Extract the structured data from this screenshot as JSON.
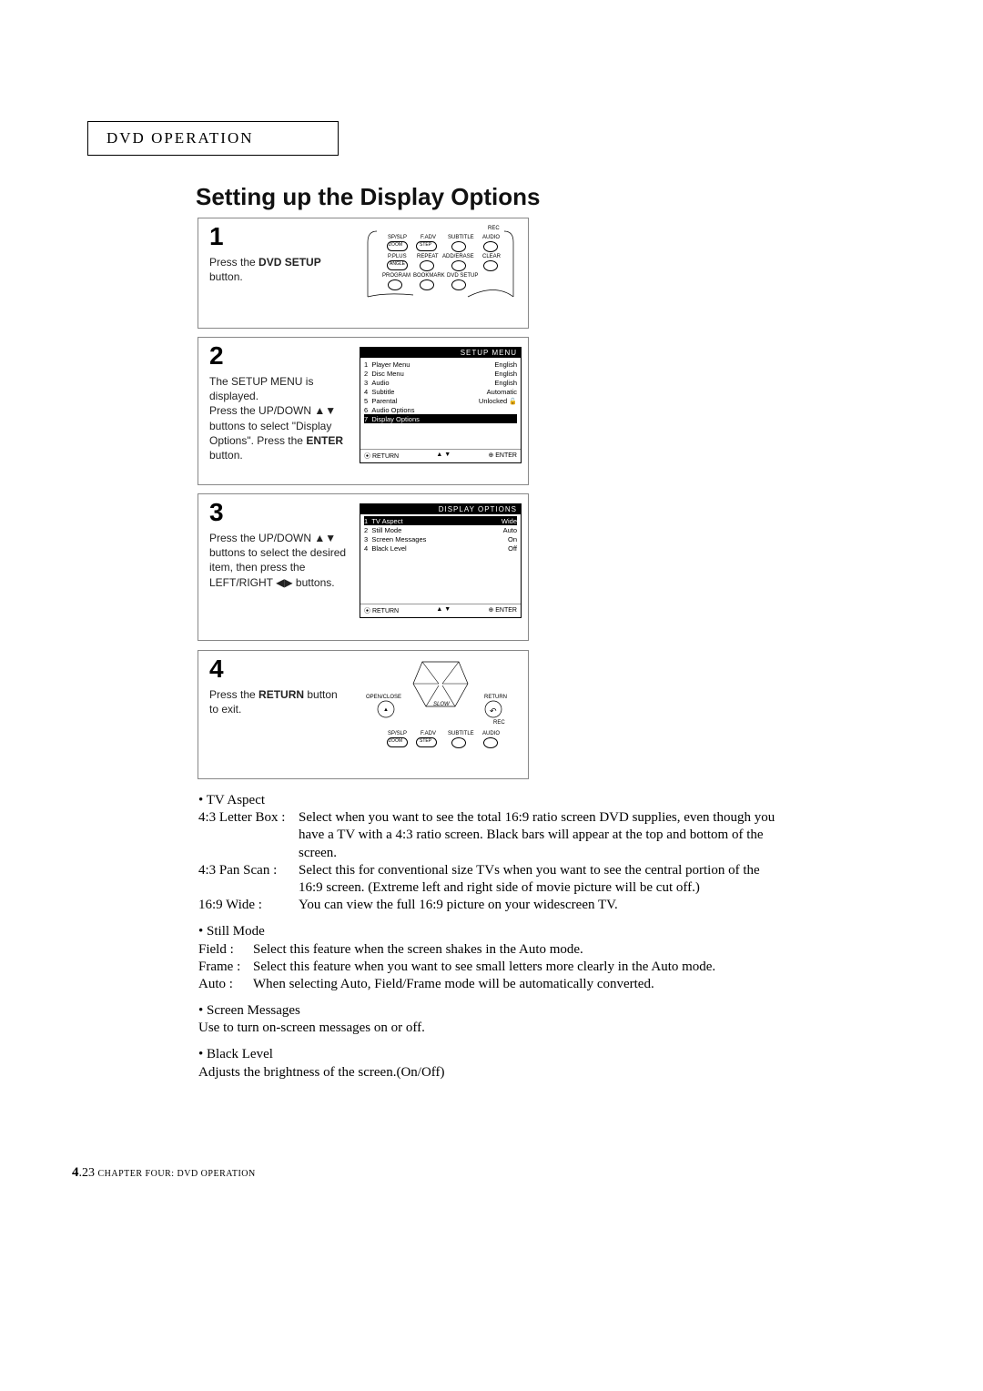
{
  "header": "DVD OPERATION",
  "title": "Setting up the Display Options",
  "steps": {
    "s1": {
      "num": "1",
      "line1a": "Press the ",
      "bold1": "DVD SETUP",
      "line1b": " button.",
      "remote": {
        "rec": "REC",
        "r1": [
          "SP/SLP",
          "F.ADV",
          "SUBTITLE",
          "AUDIO"
        ],
        "r1a": [
          "ZOOM",
          "STEP"
        ],
        "r2": [
          "P.PLUS",
          "REPEAT",
          "ADD/ERASE",
          "CLEAR"
        ],
        "r2a": [
          "ANGLE"
        ],
        "r3": [
          "PROGRAM",
          "BOOKMARK",
          "DVD SETUP"
        ]
      }
    },
    "s2": {
      "num": "2",
      "line1": "The SETUP MENU is displayed.",
      "line2a": "Press the UP/DOWN ▲▼ buttons to select \"Display Options\". Press the ",
      "bold1": "ENTER",
      "line2b": " button.",
      "screen": {
        "title": "SETUP MENU",
        "items": [
          {
            "n": "1",
            "label": "Player Menu",
            "val": "English"
          },
          {
            "n": "2",
            "label": "Disc Menu",
            "val": "English"
          },
          {
            "n": "3",
            "label": "Audio",
            "val": "English"
          },
          {
            "n": "4",
            "label": "Subtitle",
            "val": "Automatic"
          },
          {
            "n": "5",
            "label": "Parental",
            "val": "Unlocked",
            "icon": "🔓"
          },
          {
            "n": "6",
            "label": "Audio Options",
            "val": ""
          },
          {
            "n": "7",
            "label": "Display Options",
            "val": "",
            "selected": true
          }
        ],
        "foot_left": "⦿ RETURN",
        "foot_mid": "▲ ▼",
        "foot_right": "⊕ ENTER"
      }
    },
    "s3": {
      "num": "3",
      "line1": "Press the UP/DOWN ▲▼ buttons to select the desired item, then press the LEFT/RIGHT ◀▶ buttons.",
      "screen": {
        "title": "DISPLAY OPTIONS",
        "items": [
          {
            "n": "1",
            "label": "TV Aspect",
            "val": "Wide",
            "selected": true
          },
          {
            "n": "2",
            "label": "Still Mode",
            "val": "Auto"
          },
          {
            "n": "3",
            "label": "Screen Messages",
            "val": "On"
          },
          {
            "n": "4",
            "label": "Black Level",
            "val": "Off"
          }
        ],
        "foot_left": "⦿ RETURN",
        "foot_mid": "▲ ▼",
        "foot_right": "⊕ ENTER"
      }
    },
    "s4": {
      "num": "4",
      "line1a": "Press the ",
      "bold1": "RETURN",
      "line1b": " button to exit.",
      "remote": {
        "open": "OPEN/CLOSE",
        "slow": "SLOW",
        "ret": "RETURN",
        "rec": "REC",
        "r1": [
          "SP/SLP",
          "F.ADV",
          "SUBTITLE",
          "AUDIO"
        ],
        "r1a": [
          "ZOOM",
          "STEP"
        ]
      }
    }
  },
  "desc": {
    "tv_aspect": {
      "head": "TV Aspect",
      "rows": [
        {
          "term": "4:3 Letter Box :",
          "defn": "Select when you want to see the total 16:9 ratio screen DVD supplies, even though you have a TV with a 4:3 ratio screen. Black bars will appear at the top and bottom of the screen."
        },
        {
          "term": "4:3 Pan Scan :",
          "defn": "Select this for conventional size TVs when you want to see the central portion of the 16:9 screen. (Extreme left and right side of movie picture will be cut off.)"
        },
        {
          "term": "16:9 Wide :",
          "defn": "You can view the full 16:9 picture on your widescreen TV."
        }
      ]
    },
    "still_mode": {
      "head": "Still Mode",
      "rows": [
        {
          "term": "Field :",
          "defn": "Select this feature when the screen shakes in the Auto mode."
        },
        {
          "term": "Frame :",
          "defn": "Select this feature when you want to see small letters more clearly in the Auto mode."
        },
        {
          "term": "Auto :",
          "defn": "When selecting Auto, Field/Frame mode will be automatically converted."
        }
      ]
    },
    "screen_messages": {
      "head": "Screen Messages",
      "body": "Use to turn on-screen messages on or off."
    },
    "black_level": {
      "head": "Black Level",
      "body": "Adjusts the brightness of the screen.(On/Off)"
    }
  },
  "footer": {
    "major": "4",
    "dot": ".",
    "minor": "23",
    "chapter": " CHAPTER FOUR: DVD OPERATION"
  }
}
